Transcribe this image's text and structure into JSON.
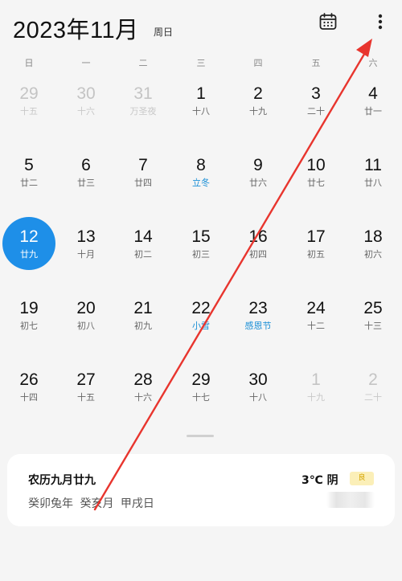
{
  "header": {
    "title": "2023年11月",
    "weekday": "周日",
    "calendar_icon": "calendar-icon",
    "more_icon": "more-vertical-icon"
  },
  "weekdays": [
    "日",
    "一",
    "二",
    "三",
    "四",
    "五",
    "六"
  ],
  "weeks": [
    [
      {
        "day": "29",
        "sub": "十五",
        "other": true
      },
      {
        "day": "30",
        "sub": "十六",
        "other": true
      },
      {
        "day": "31",
        "sub": "万圣夜",
        "other": true
      },
      {
        "day": "1",
        "sub": "十八"
      },
      {
        "day": "2",
        "sub": "十九"
      },
      {
        "day": "3",
        "sub": "二十"
      },
      {
        "day": "4",
        "sub": "廿一"
      }
    ],
    [
      {
        "day": "5",
        "sub": "廿二"
      },
      {
        "day": "6",
        "sub": "廿三"
      },
      {
        "day": "7",
        "sub": "廿四"
      },
      {
        "day": "8",
        "sub": "立冬",
        "term": true
      },
      {
        "day": "9",
        "sub": "廿六"
      },
      {
        "day": "10",
        "sub": "廿七"
      },
      {
        "day": "11",
        "sub": "廿八"
      }
    ],
    [
      {
        "day": "12",
        "sub": "廿九",
        "today": true
      },
      {
        "day": "13",
        "sub": "十月"
      },
      {
        "day": "14",
        "sub": "初二"
      },
      {
        "day": "15",
        "sub": "初三"
      },
      {
        "day": "16",
        "sub": "初四"
      },
      {
        "day": "17",
        "sub": "初五"
      },
      {
        "day": "18",
        "sub": "初六"
      }
    ],
    [
      {
        "day": "19",
        "sub": "初七"
      },
      {
        "day": "20",
        "sub": "初八"
      },
      {
        "day": "21",
        "sub": "初九"
      },
      {
        "day": "22",
        "sub": "小雪",
        "term": true
      },
      {
        "day": "23",
        "sub": "感恩节",
        "term": true
      },
      {
        "day": "24",
        "sub": "十二"
      },
      {
        "day": "25",
        "sub": "十三"
      }
    ],
    [
      {
        "day": "26",
        "sub": "十四"
      },
      {
        "day": "27",
        "sub": "十五"
      },
      {
        "day": "28",
        "sub": "十六"
      },
      {
        "day": "29",
        "sub": "十七"
      },
      {
        "day": "30",
        "sub": "十八"
      },
      {
        "day": "1",
        "sub": "十九",
        "other": true
      },
      {
        "day": "2",
        "sub": "二十",
        "other": true
      }
    ]
  ],
  "card": {
    "lunar_date": "农历九月廿九",
    "ganzhi": "癸卯兔年 癸亥月 甲戌日",
    "weather": "3℃ 阴",
    "aqi": "良"
  },
  "colors": {
    "accent": "#1e8fe8",
    "term_text": "#1a8fd6",
    "annotation_arrow": "#e8352e"
  }
}
